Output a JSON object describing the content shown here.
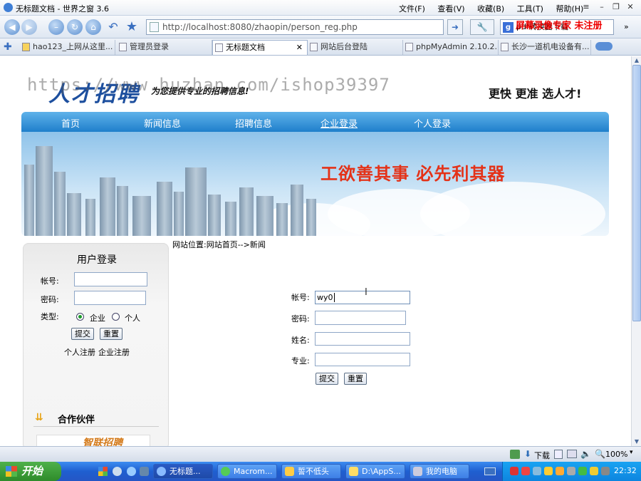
{
  "window": {
    "title": "无标题文档 - 世界之窗 3.6"
  },
  "menu": [
    "文件(F)",
    "查看(V)",
    "收藏(B)",
    "工具(T)",
    "帮助(H)"
  ],
  "address": {
    "url": "http://localhost:8080/zhaopin/person_reg.php"
  },
  "search": {
    "value": "pdf转换器下载"
  },
  "recorder_overlay": "屏幕录像专家  未注册",
  "tabs": [
    "hao123_上网从这里...",
    "管理员登录",
    "无标题文档",
    "网站后台登陆",
    "phpMyAdmin 2.10.2...",
    "长沙一道机电设备有..."
  ],
  "page": {
    "logo": "人才招聘",
    "slogan": "为您提供专业的招聘信息!",
    "tagline": "更快 更准 选人才!",
    "watermark": "https://www.huzhan.com/ishop39397",
    "nav": [
      "首页",
      "新闻信息",
      "招聘信息",
      "企业登录",
      "个人登录"
    ],
    "banner_text": "工欲善其事  必先利其器",
    "login": {
      "title": "用户登录",
      "account_label": "帐号:",
      "password_label": "密码:",
      "type_label": "类型:",
      "type_options": [
        "企业",
        "个人"
      ],
      "submit": "提交",
      "reset": "重置",
      "person_reg": "个人注册",
      "company_reg": "企业注册"
    },
    "partner_title": "合作伙伴",
    "partner_logo": "智联招聘",
    "breadcrumb": "网站位置:网站首页-->新闻",
    "reg_form": {
      "account_label": "帐号:",
      "account_value": "wy0",
      "password_label": "密码:",
      "name_label": "姓名:",
      "major_label": "专业:",
      "submit": "提交",
      "reset": "重置"
    }
  },
  "status": {
    "download": "下载",
    "zoom": "100%"
  },
  "taskbar": {
    "start": "开始",
    "items": [
      "无标题...",
      "Macrom...",
      "誓不低头",
      "D:\\AppS...",
      "我的电脑"
    ],
    "clock": "22:32"
  }
}
